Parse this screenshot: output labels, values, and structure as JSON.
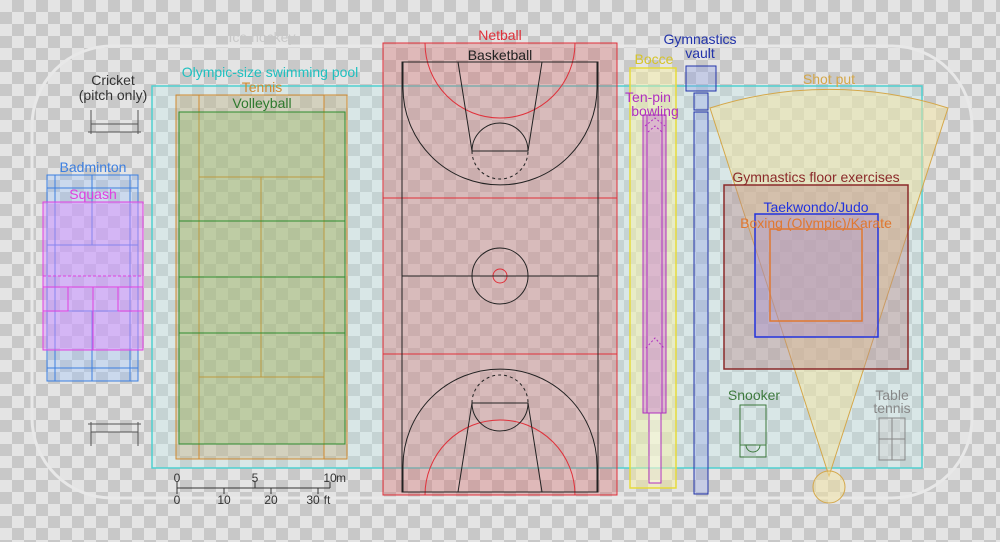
{
  "labels": {
    "ice_hockey": "Ice hockey",
    "cricket_line1": "Cricket",
    "cricket_line2": "(pitch only)",
    "swimming_pool": "Olympic-size swimming pool",
    "tennis": "Tennis",
    "volleyball": "Volleyball",
    "badminton": "Badminton",
    "squash": "Squash",
    "netball": "Netball",
    "basketball": "Basketball",
    "bocce": "Bocce",
    "ten_pin_line1": "Ten-pin",
    "ten_pin_line2": "bowling",
    "vault_line1": "Gymnastics",
    "vault_line2": "vault",
    "shot_put": "Shot put",
    "gymnastics_floor": "Gymnastics floor exercises",
    "taekwondo": "Taekwondo/Judo",
    "boxing": "Boxing (Olympic)/Karate",
    "snooker": "Snooker",
    "table_tennis_line1": "Table",
    "table_tennis_line2": "tennis"
  },
  "scale": {
    "m_ticks": [
      "0",
      "5",
      "10"
    ],
    "m_unit": "m",
    "ft_ticks": [
      "0",
      "10",
      "20",
      "30"
    ],
    "ft_unit": "ft"
  },
  "colors": {
    "netball": "#e0303a",
    "swimming_pool": "#20c0c0",
    "tennis": "#d08a30",
    "volleyball": "#2e7a2e",
    "badminton": "#3d7fe0",
    "squash": "#e040e0",
    "bocce": "#d6c42a",
    "ten_pin": "#b030c0",
    "vault": "#2233aa",
    "shot_put": "#d4a74a",
    "gymnastics_floor": "#8b2a2a",
    "taekwondo": "#2233dd",
    "boxing": "#e07830",
    "snooker": "#3d7a3d"
  }
}
